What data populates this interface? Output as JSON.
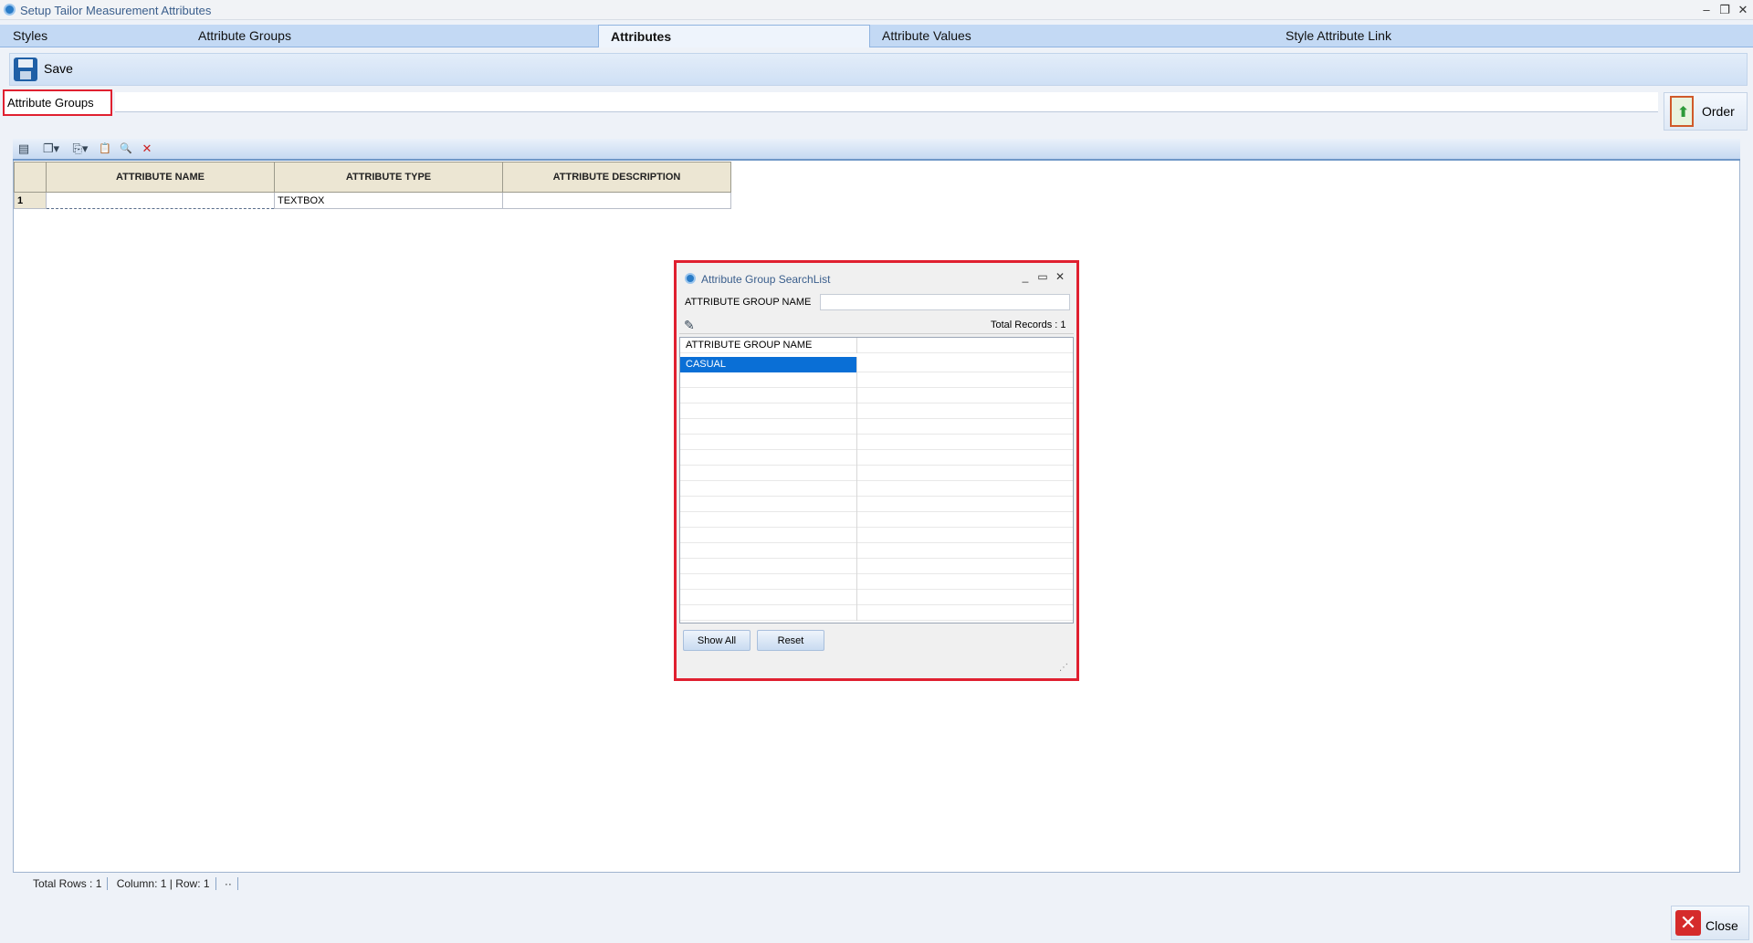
{
  "window": {
    "title": "Setup Tailor Measurement Attributes",
    "controls": [
      "–",
      "❐",
      "✕"
    ]
  },
  "tabs": [
    {
      "label": "Styles",
      "active": false
    },
    {
      "label": "Attribute Groups",
      "active": false
    },
    {
      "label": "Attributes",
      "active": true
    },
    {
      "label": "Attribute Values",
      "active": false
    },
    {
      "label": "Style Attribute Link",
      "active": false
    }
  ],
  "toolbar": {
    "save_label": "Save",
    "save_icon": "floppy-disk-icon"
  },
  "attribute_groups": {
    "label": "Attribute Groups",
    "value": "",
    "order_label": "Order"
  },
  "grid_toolbar": {
    "icons": [
      "add-row-icon",
      "copy-icon",
      "export-icon",
      "paste-icon",
      "find-icon",
      "delete-icon"
    ],
    "glyphs": [
      "▤",
      "❐▾",
      "⎘▾",
      "📋",
      "🔍",
      "✕"
    ]
  },
  "grid": {
    "columns": [
      "ATTRIBUTE NAME",
      "ATTRIBUTE TYPE",
      "ATTRIBUTE DESCRIPTION"
    ],
    "rows": [
      {
        "num": "1",
        "name": "",
        "type": "TEXTBOX",
        "description": ""
      }
    ]
  },
  "status": {
    "total_rows": "Total Rows : 1",
    "position": "Column: 1 | Row: 1",
    "more": "··"
  },
  "close_label": "Close",
  "dialog": {
    "title": "Attribute Group SearchList",
    "controls": [
      "_",
      "▭",
      "✕"
    ],
    "filter_label": "ATTRIBUTE GROUP NAME",
    "filter_value": "",
    "total_records": "Total Records : 1",
    "list_header": "ATTRIBUTE GROUP NAME",
    "items": [
      "CASUAL"
    ],
    "show_all_label": "Show All",
    "reset_label": "Reset"
  }
}
